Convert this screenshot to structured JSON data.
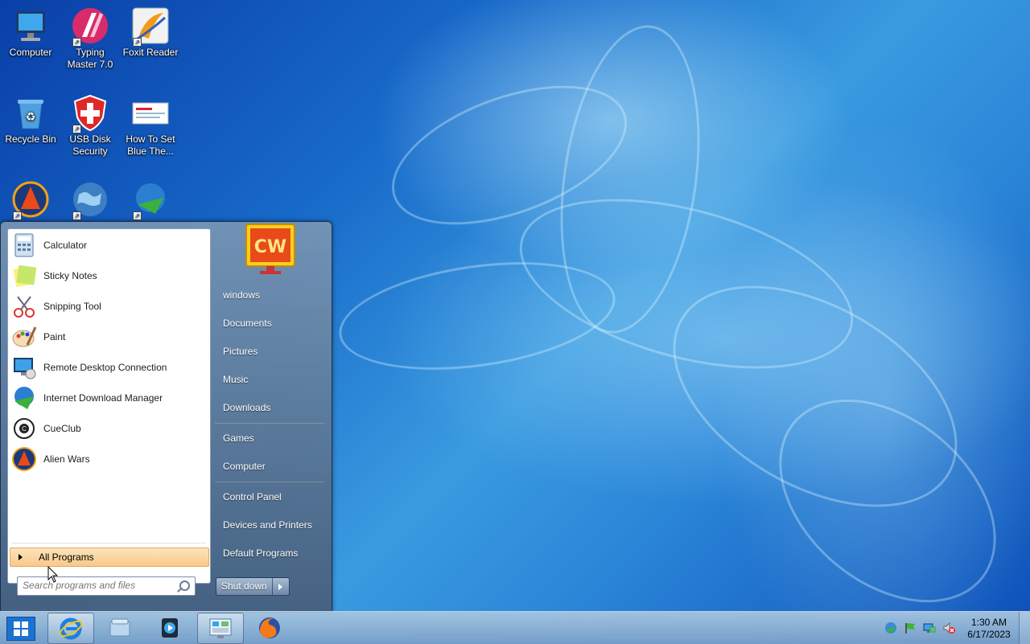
{
  "desktop": {
    "icons": [
      {
        "label": "Computer"
      },
      {
        "label": "Typing\nMaster 7.0"
      },
      {
        "label": "Foxit Reader"
      },
      {
        "label": "Recycle Bin"
      },
      {
        "label": "USB Disk\nSecurity"
      },
      {
        "label": "How To Set\nBlue The..."
      }
    ]
  },
  "start_menu": {
    "programs": [
      {
        "label": "Calculator",
        "icon": "calculator-icon"
      },
      {
        "label": "Sticky Notes",
        "icon": "sticky-notes-icon"
      },
      {
        "label": "Snipping Tool",
        "icon": "scissors-icon"
      },
      {
        "label": "Paint",
        "icon": "paint-palette-icon"
      },
      {
        "label": "Remote Desktop Connection",
        "icon": "remote-desktop-icon"
      },
      {
        "label": "Internet Download Manager",
        "icon": "idm-globe-icon"
      },
      {
        "label": "CueClub",
        "icon": "cue-ball-icon"
      },
      {
        "label": "Alien Wars",
        "icon": "alien-wars-icon"
      }
    ],
    "all_programs": "All Programs",
    "search_placeholder": "Search programs and files",
    "right_links": {
      "user": "windows",
      "documents": "Documents",
      "pictures": "Pictures",
      "music": "Music",
      "downloads": "Downloads",
      "games": "Games",
      "computer": "Computer",
      "control_panel": "Control Panel",
      "devices": "Devices and Printers",
      "default_programs": "Default Programs"
    },
    "shutdown_label": "Shut down"
  },
  "taskbar": {
    "pinned": [
      "internet-explorer-icon",
      "file-explorer-icon",
      "media-player-icon",
      "control-panel-icon",
      "firefox-icon"
    ],
    "clock_time": "1:30 AM",
    "clock_date": "6/17/2023"
  },
  "colors": {
    "accent": "#1a73d1",
    "all_programs_highlight": "#f8c98a"
  }
}
